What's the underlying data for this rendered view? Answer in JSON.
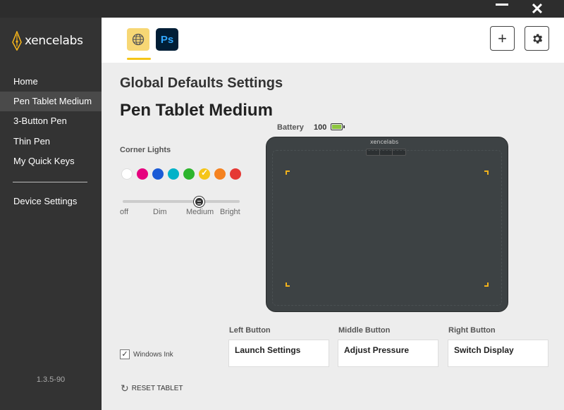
{
  "window": {
    "close_glyph": "✕"
  },
  "brand": {
    "logo_text": "xencelabs",
    "icon": "pen-nib-logo-icon"
  },
  "sidebar": {
    "items": [
      {
        "label": "Home"
      },
      {
        "label": "Pen Tablet Medium"
      },
      {
        "label": "3-Button Pen"
      },
      {
        "label": "Thin Pen"
      },
      {
        "label": "My Quick Keys"
      },
      {
        "label": "Device Settings"
      }
    ],
    "active_index": 1,
    "version": "1.3.5-90"
  },
  "header": {
    "apps": [
      {
        "icon": "globe-icon",
        "selected": true
      },
      {
        "label": "Ps",
        "icon": "photoshop-icon"
      }
    ],
    "add_glyph": "+",
    "settings_icon": "gear-icon"
  },
  "main": {
    "section_title": "Global Defaults Settings",
    "device_title": "Pen Tablet Medium",
    "corner_lights": {
      "label": "Corner Lights",
      "colors": [
        "#ffffff",
        "#e6007e",
        "#1b5bd6",
        "#00b2c8",
        "#2db52d",
        "#f5c518",
        "#f58220",
        "#e53935"
      ],
      "selected_index": 5,
      "brightness_levels": [
        "off",
        "Dim",
        "Medium",
        "Bright"
      ],
      "brightness_selected": "Medium"
    },
    "battery": {
      "label": "Battery",
      "value": "100",
      "icon": "battery-full-icon",
      "color": "#8dc63f"
    },
    "tablet": {
      "logo_text": "xencelabs",
      "corner_color": "#f2b21b"
    },
    "buttons": [
      {
        "label": "Left Button",
        "value": "Launch Settings"
      },
      {
        "label": "Middle Button",
        "value": "Adjust Pressure"
      },
      {
        "label": "Right Button",
        "value": "Switch Display"
      }
    ],
    "windows_ink": {
      "label": "Windows Ink",
      "checked": true,
      "check_glyph": "✓"
    },
    "reset": {
      "label": "RESET TABLET",
      "icon": "reset-icon",
      "glyph": "↻"
    }
  }
}
